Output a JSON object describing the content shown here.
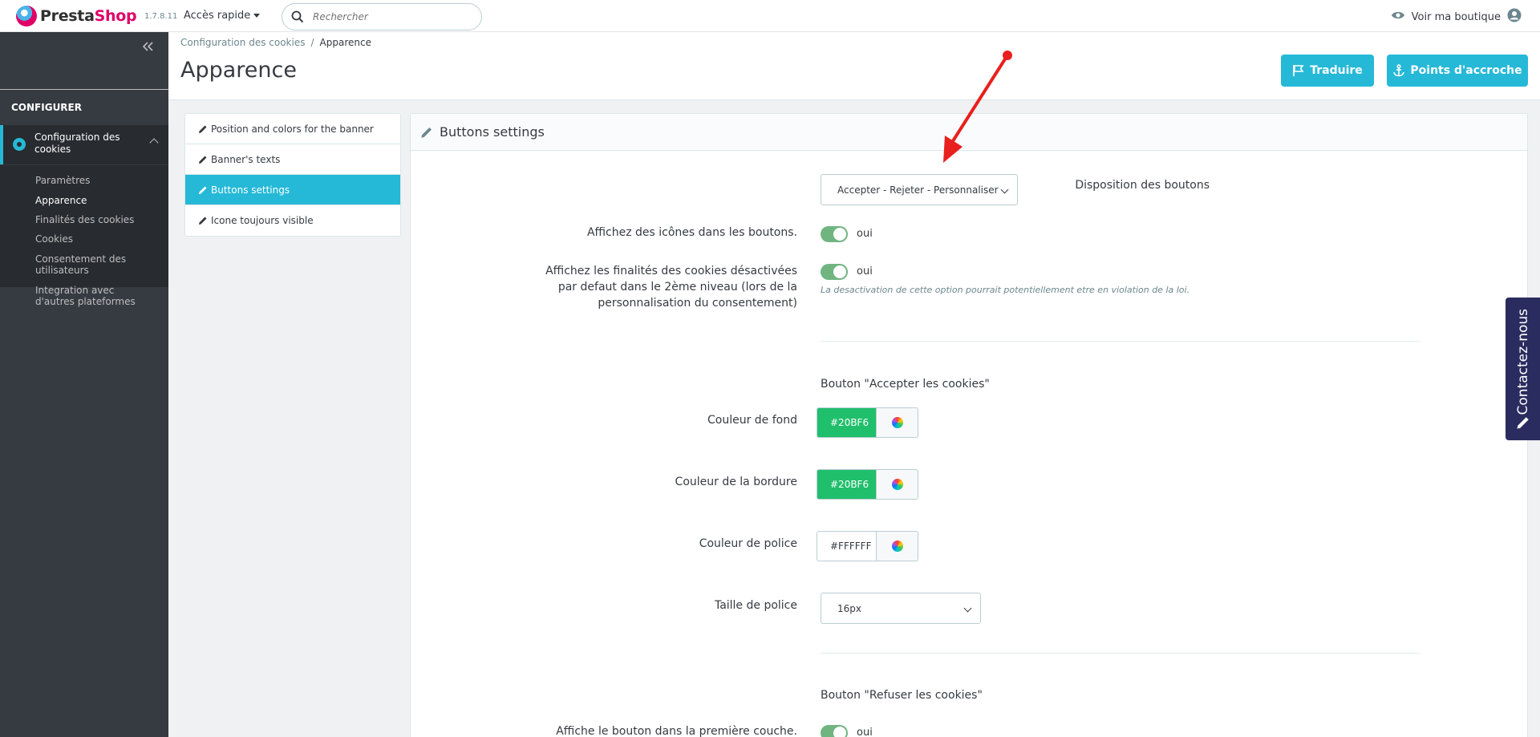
{
  "topbar": {
    "logo_presta": "Presta",
    "logo_shop": "Shop",
    "version": "1.7.8.11",
    "quick_access": "Accès rapide",
    "search_placeholder": "Rechercher",
    "view_shop": "Voir ma boutique"
  },
  "sidebar": {
    "collapse_icon": "double-chevron-left-icon",
    "section_title": "CONFIGURER",
    "active_item": "Configuration des cookies",
    "sub_items": [
      {
        "label": "Paramètres"
      },
      {
        "label": "Apparence"
      },
      {
        "label": "Finalités des cookies"
      },
      {
        "label": "Cookies"
      },
      {
        "label": "Consentement des utilisateurs"
      },
      {
        "label": "Integration avec d'autres plateformes"
      }
    ]
  },
  "header": {
    "breadcrumb": [
      "Configuration des cookies",
      "Apparence"
    ],
    "breadcrumb_sep": "/",
    "title": "Apparence",
    "translate_button": "Traduire",
    "hooks_button": "Points d'accroche"
  },
  "tabs": [
    {
      "label": "Position and colors for the banner"
    },
    {
      "label": "Banner's texts"
    },
    {
      "label": "Buttons settings"
    },
    {
      "label": "Icone toujours visible"
    }
  ],
  "panel": {
    "title": "Buttons settings",
    "layout_label": "Disposition des boutons",
    "layout_value": "Accepter - Rejeter - Personnaliser",
    "show_icons_label": "Affichez des icônes dans les boutons.",
    "show_icons_value": "oui",
    "show_purposes_label": "Affichez les finalités des cookies désactivées par defaut dans le 2ème niveau (lors de la personnalisation du consentement)",
    "show_purposes_value": "oui",
    "show_purposes_help": "La desactivation de cette option pourrait potentiellement etre en violation de la loi.",
    "accept_section": "Bouton \"Accepter les cookies\"",
    "bg_color_label": "Couleur de fond",
    "bg_color_value": "#20BF6",
    "border_color_label": "Couleur de la bordure",
    "border_color_value": "#20BF6",
    "font_color_label": "Couleur de police",
    "font_color_value": "#FFFFFF",
    "font_size_label": "Taille de police",
    "font_size_value": "16px",
    "refuse_section": "Bouton \"Refuser les cookies\"",
    "first_layer_label": "Affiche le bouton dans la première couche.",
    "first_layer_value": "oui"
  },
  "contact": {
    "label": "Contactez-nous"
  },
  "colors": {
    "accent": "#25b9d7",
    "sidebar_bg": "#363a41",
    "green": "#20bf6b",
    "toggle": "#70b580",
    "contact_bg": "#2a2c5f",
    "arrow": "#e8201e"
  }
}
